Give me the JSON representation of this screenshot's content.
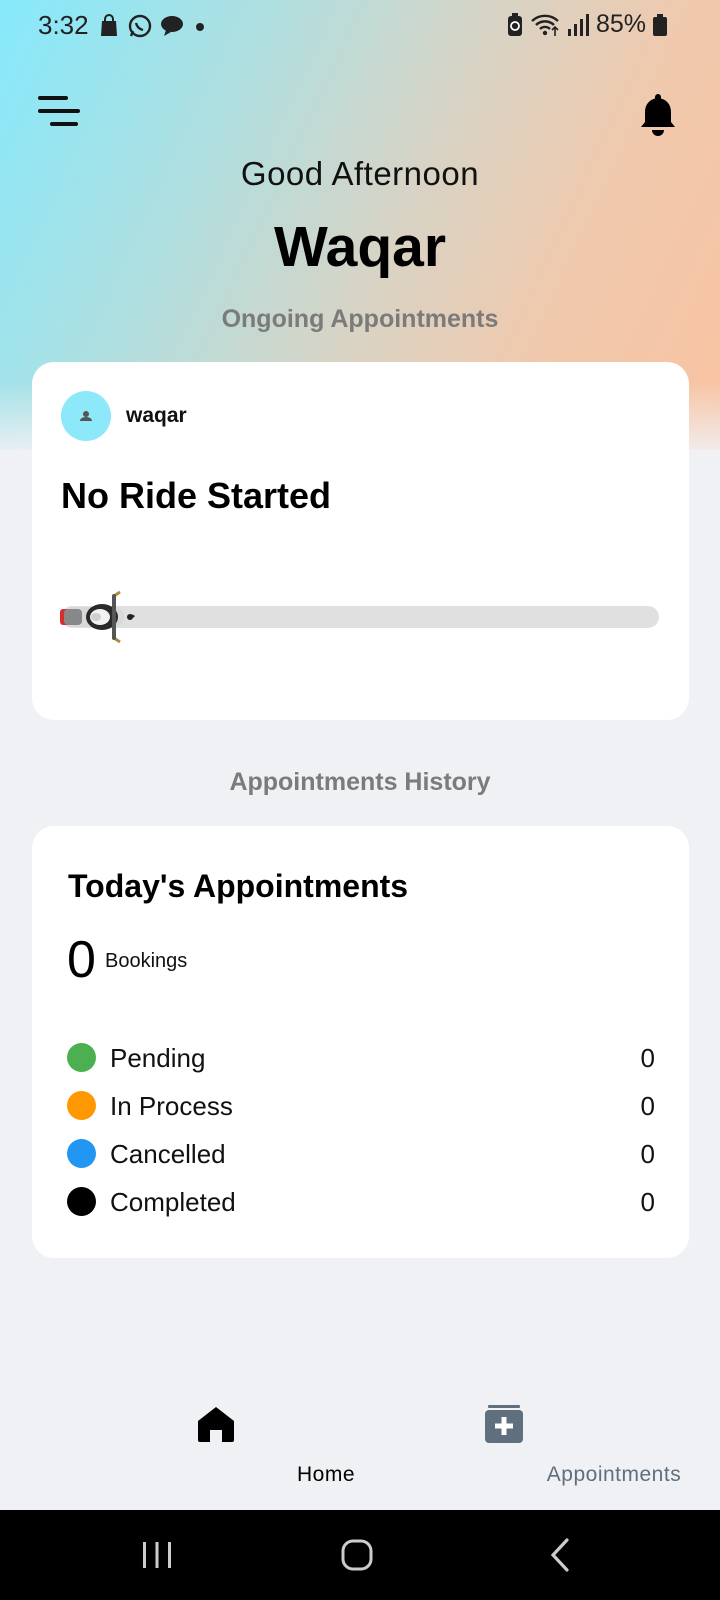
{
  "status_bar": {
    "time": "3:32",
    "battery": "85%"
  },
  "header": {
    "greeting": "Good Afternoon",
    "username": "Waqar"
  },
  "ongoing": {
    "section_label": "Ongoing Appointments",
    "user_name": "waqar",
    "ride_status": "No Ride Started",
    "ride_progress": 0
  },
  "history": {
    "section_label": "Appointments History",
    "title": "Today's Appointments",
    "bookings_count": "0",
    "bookings_label": "Bookings",
    "stats": [
      {
        "label": "Pending",
        "value": "0",
        "color": "#4caf50"
      },
      {
        "label": "In Process",
        "value": "0",
        "color": "#ff9800"
      },
      {
        "label": "Cancelled",
        "value": "0",
        "color": "#2196f3"
      },
      {
        "label": "Completed",
        "value": "0",
        "color": "#000000"
      }
    ]
  },
  "bottom_nav": {
    "items": [
      {
        "label": "Home",
        "icon": "home-icon",
        "active": true
      },
      {
        "label": "Appointments",
        "icon": "medical-box-icon",
        "active": false
      }
    ]
  },
  "colors": {
    "accent_cyan": "#8de8fa",
    "active_nav": "#000000",
    "inactive_nav": "#5f6f7d"
  }
}
